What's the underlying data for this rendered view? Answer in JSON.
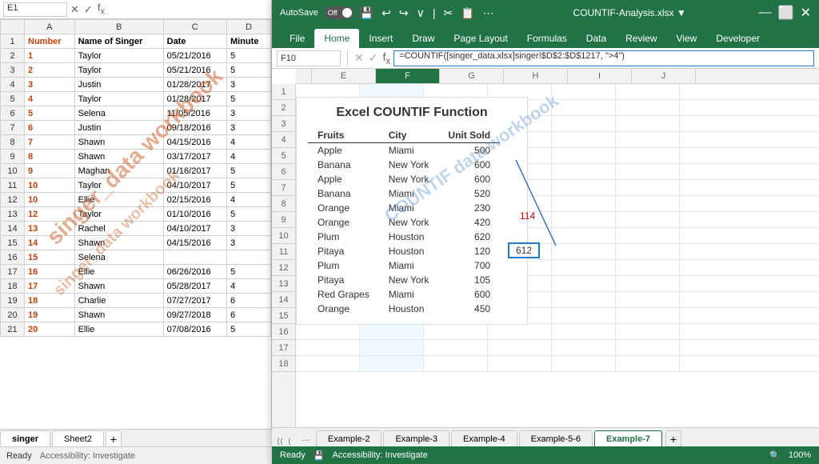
{
  "background": {
    "name_box": "E1",
    "sheet_tabs": [
      "singer",
      "Sheet2"
    ],
    "status": "Ready",
    "accessibility": "Accessibility: Investigate",
    "watermark1": "singer_data workbook",
    "watermark2": "singer_data workbook",
    "rows": [
      {
        "num": 1,
        "number": "Number",
        "name": "Name of Singer",
        "date": "Date",
        "minute": "Minute"
      },
      {
        "num": 2,
        "number": "1",
        "name": "Taylor",
        "date": "05/21/2016",
        "minute": "5"
      },
      {
        "num": 3,
        "number": "2",
        "name": "Taylor",
        "date": "05/21/2016",
        "minute": "5"
      },
      {
        "num": 4,
        "number": "3",
        "name": "Justin",
        "date": "01/28/2017",
        "minute": "3"
      },
      {
        "num": 5,
        "number": "4",
        "name": "Taylor",
        "date": "01/28/2017",
        "minute": "5"
      },
      {
        "num": 6,
        "number": "5",
        "name": "Selena",
        "date": "11/05/2016",
        "minute": "3"
      },
      {
        "num": 7,
        "number": "6",
        "name": "Justin",
        "date": "09/18/2016",
        "minute": "3"
      },
      {
        "num": 8,
        "number": "7",
        "name": "Shawn",
        "date": "04/15/2016",
        "minute": "4"
      },
      {
        "num": 9,
        "number": "8",
        "name": "Shawn",
        "date": "03/17/2017",
        "minute": "4"
      },
      {
        "num": 10,
        "number": "9",
        "name": "Maghan",
        "date": "01/16/2017",
        "minute": "5"
      },
      {
        "num": 11,
        "number": "10",
        "name": "Taylor",
        "date": "04/10/2017",
        "minute": "5"
      },
      {
        "num": 12,
        "number": "10",
        "name": "Ellie",
        "date": "02/15/2016",
        "minute": "4"
      },
      {
        "num": 13,
        "number": "12",
        "name": "Taylor",
        "date": "01/10/2016",
        "minute": "5"
      },
      {
        "num": 14,
        "number": "13",
        "name": "Rachel",
        "date": "04/10/2017",
        "minute": "3"
      },
      {
        "num": 15,
        "number": "14",
        "name": "Shawn",
        "date": "04/15/2016",
        "minute": "3"
      },
      {
        "num": 16,
        "number": "15",
        "name": "Selena",
        "date": ""
      },
      {
        "num": 17,
        "number": "16",
        "name": "Ellie",
        "date": "06/26/2016",
        "minute": "5"
      },
      {
        "num": 18,
        "number": "17",
        "name": "Shawn",
        "date": "05/28/2017",
        "minute": "4"
      },
      {
        "num": 19,
        "number": "18",
        "name": "Charlie",
        "date": "07/27/2017",
        "minute": "6"
      },
      {
        "num": 20,
        "number": "19",
        "name": "Shawn",
        "date": "09/27/2018",
        "minute": "6"
      },
      {
        "num": 21,
        "number": "20",
        "name": "Ellie",
        "date": "07/08/2016",
        "minute": "5"
      }
    ]
  },
  "excel": {
    "title": "COUNTIF-Analysis.xlsx",
    "autosave_label": "AutoSave",
    "autosave_state": "Off",
    "name_box": "F10",
    "formula": "=COUNTIF([singer_data.xlsx]singer!$D$2:$D$1217, \">4\")",
    "ribbon_tabs": [
      "File",
      "Home",
      "Insert",
      "Draw",
      "Page Layout",
      "Formulas",
      "Data",
      "Review",
      "View",
      "Developer"
    ],
    "active_tab": "Home",
    "card_title": "Excel COUNTIF Function",
    "table_headers": [
      "Fruits",
      "City",
      "Unit Sold"
    ],
    "table_rows": [
      {
        "fruit": "Apple",
        "city": "Miami",
        "units": "500"
      },
      {
        "fruit": "Banana",
        "city": "New York",
        "units": "600"
      },
      {
        "fruit": "Apple",
        "city": "New York",
        "units": "600"
      },
      {
        "fruit": "Banana",
        "city": "Miami",
        "units": "520"
      },
      {
        "fruit": "Orange",
        "city": "Miami",
        "units": "230"
      },
      {
        "fruit": "Orange",
        "city": "New York",
        "units": "420"
      },
      {
        "fruit": "Plum",
        "city": "Houston",
        "units": "620"
      },
      {
        "fruit": "Pitaya",
        "city": "Houston",
        "units": "120"
      },
      {
        "fruit": "Plum",
        "city": "Miami",
        "units": "700"
      },
      {
        "fruit": "Pitaya",
        "city": "New York",
        "units": "105"
      },
      {
        "fruit": "Red Grapes",
        "city": "Miami",
        "units": "600"
      },
      {
        "fruit": "Orange",
        "city": "Houston",
        "units": "450"
      }
    ],
    "result1": "114",
    "result2": "612",
    "watermark": "COUNTIF data workbook",
    "sheet_tabs": [
      "Example-2",
      "Example-3",
      "Example-4",
      "Example-5-6",
      "Example-7"
    ],
    "active_sheet": "Example-7",
    "status_left": "Ready",
    "status_accessibility": "Accessibility: Investigate",
    "col_headers": [
      "E",
      "F",
      "G",
      "H",
      "I",
      "J"
    ],
    "zoom": "100%"
  }
}
